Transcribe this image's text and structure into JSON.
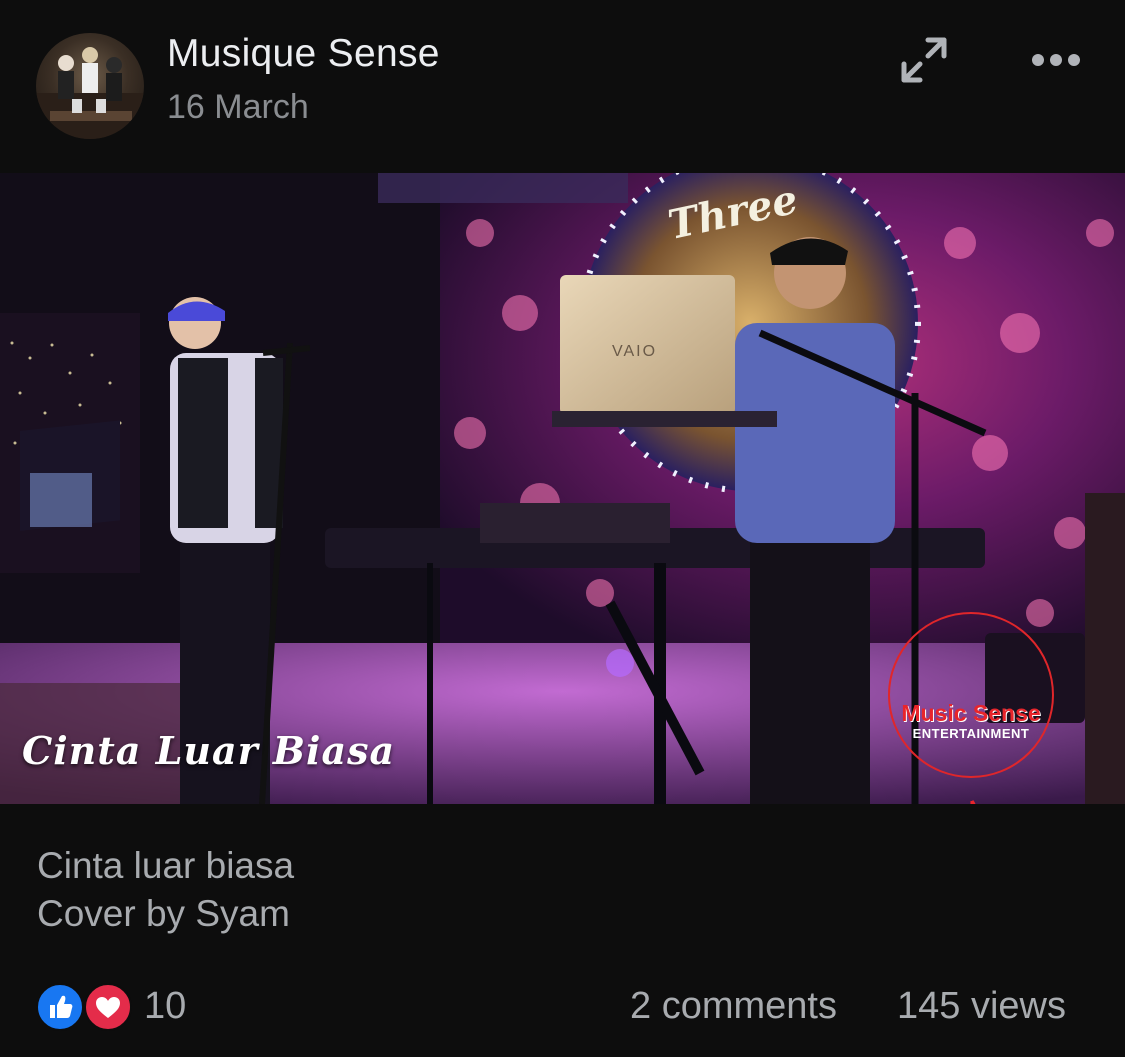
{
  "post": {
    "page_name": "Musique Sense",
    "date": "16 March",
    "caption_lines": [
      "Cinta luar biasa",
      "Cover by Syam"
    ]
  },
  "video": {
    "overlay_title": "Cinta Luar Biasa",
    "laptop_brand": "VAIO",
    "sign_text": "Three",
    "logo_line_1": "Music Sense",
    "logo_line_2": "ENTERTAINMENT"
  },
  "footer": {
    "reaction_count": "10",
    "comments": "2 comments",
    "views": "145 views"
  },
  "icons": {
    "avatar": "page-avatar",
    "expand": "expand-icon",
    "more": "more-dots-icon",
    "like": "like-reaction-icon",
    "love": "love-reaction-icon"
  },
  "colors": {
    "background": "#0d0d0d",
    "like_blue": "#1877f2",
    "love_red": "#e42c4a",
    "secondary_text": "#8a8d91"
  }
}
